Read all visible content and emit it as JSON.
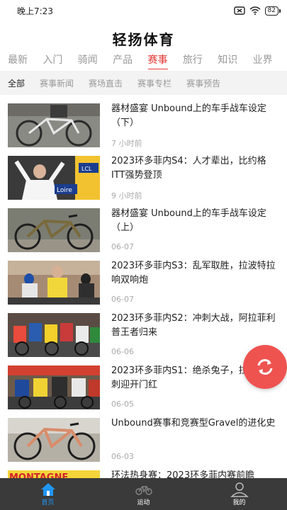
{
  "status_bar": {
    "time": "晚上7:23",
    "battery": "82"
  },
  "app": {
    "title": "轻扬体育"
  },
  "tabs": [
    {
      "label": "最新",
      "active": false
    },
    {
      "label": "入门",
      "active": false
    },
    {
      "label": "骑闻",
      "active": false
    },
    {
      "label": "产品",
      "active": false
    },
    {
      "label": "赛事",
      "active": true
    },
    {
      "label": "旅行",
      "active": false
    },
    {
      "label": "知识",
      "active": false
    },
    {
      "label": "业界",
      "active": false
    }
  ],
  "subtabs": [
    {
      "label": "全部",
      "active": true
    },
    {
      "label": "赛事新闻",
      "active": false
    },
    {
      "label": "赛场直击",
      "active": false
    },
    {
      "label": "赛事专栏",
      "active": false
    },
    {
      "label": "赛事预告",
      "active": false
    }
  ],
  "feed": [
    {
      "title": "器材盛宴 Unbound上的车手战车设定（下）",
      "time": "7 小时前"
    },
    {
      "title": "2023环多菲内S4：人才辈出，比约格ITT强势登顶",
      "time": "9 小时前"
    },
    {
      "title": "器材盛宴 Unbound上的车手战车设定（上）",
      "time": "06-07"
    },
    {
      "title": "2023环多菲内S3：乱军取胜，拉波特拉响双响炮",
      "time": "06-07"
    },
    {
      "title": "2023环多菲内S2：冲刺大战，阿拉菲利普王者归来",
      "time": "06-06"
    },
    {
      "title": "2023环多菲内S1：绝杀兔子，拉波特冲刺迎开门红",
      "time": "06-05"
    },
    {
      "title": "Unbound赛事和竞赛型Gravel的进化史",
      "time": "06-03"
    },
    {
      "title": "环法热身赛：2023环多菲内赛前瞻",
      "time": ""
    }
  ],
  "thumb_text": {
    "loire": "Loire",
    "lcl": "LCL",
    "montagne": "MONTAGNE"
  },
  "bottom_nav": [
    {
      "label": "首页",
      "icon": "home-icon",
      "active": true
    },
    {
      "label": "运动",
      "icon": "bicycle-icon",
      "active": false
    },
    {
      "label": "我的",
      "icon": "user-icon",
      "active": false
    }
  ],
  "colors": {
    "accent": "#e53935",
    "fab": "#ef5350",
    "nav_bg": "#3a3a3a",
    "nav_active": "#2196f3"
  }
}
